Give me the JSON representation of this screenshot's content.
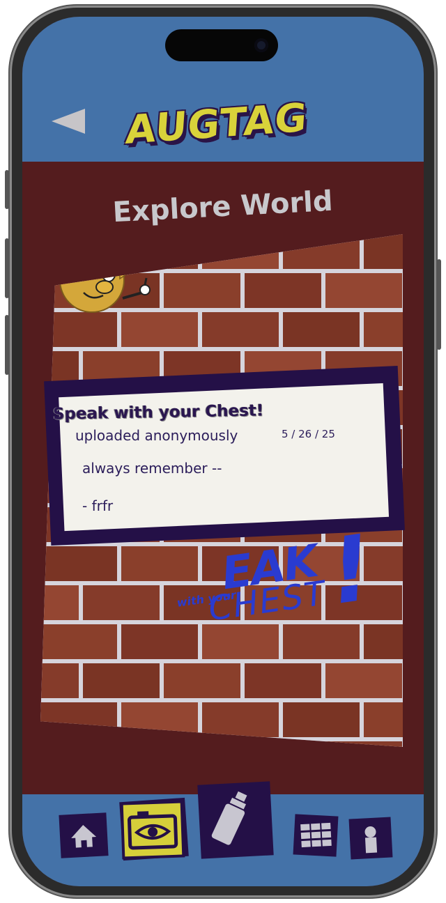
{
  "app": {
    "logo_text": "AUGTAG"
  },
  "header": {
    "back_icon": "back-arrow-icon"
  },
  "page": {
    "title": "Explore World"
  },
  "tag_card": {
    "title": "Speak with your Chest!",
    "uploader": "uploaded anonymously",
    "date": "5 / 26 / 25",
    "body_line1": "always remember --",
    "body_line2": "- frfr"
  },
  "graffiti": {
    "big": "EAK",
    "small": "with your",
    "chest": "CHEST",
    "exclaim": "!"
  },
  "nav": {
    "items": [
      {
        "name": "home",
        "icon": "home-icon"
      },
      {
        "name": "camera",
        "icon": "camera-eye-icon",
        "active": true
      },
      {
        "name": "spray",
        "icon": "spray-can-icon"
      },
      {
        "name": "grid",
        "icon": "grid-icon"
      },
      {
        "name": "profile",
        "icon": "profile-icon"
      }
    ]
  },
  "colors": {
    "header_blue": "#4472a8",
    "background_maroon": "#541c1e",
    "navy_purple": "#241047",
    "accent_yellow": "#d6cf3a",
    "card_paper": "#f3f2ec",
    "brick": "#8a3f2b",
    "mortar": "#d6d4dc"
  }
}
